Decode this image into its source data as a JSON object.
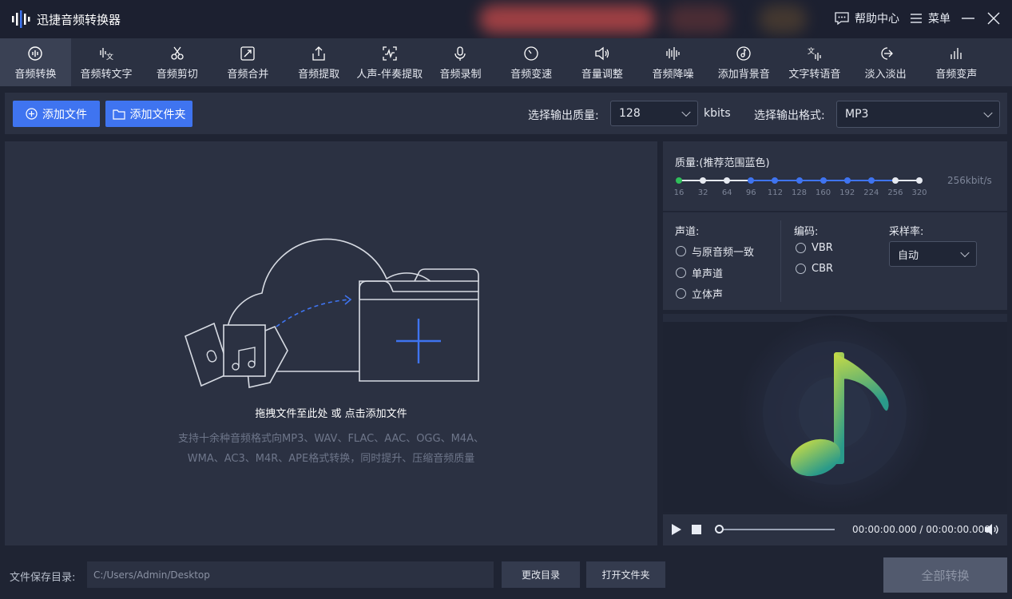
{
  "app": {
    "title": "迅捷音频转换器"
  },
  "header": {
    "help_label": "帮助中心",
    "menu_label": "菜单"
  },
  "toolbar": {
    "items": [
      {
        "label": "音频转换",
        "icon": "audio-convert-icon",
        "active": true
      },
      {
        "label": "音频转文字",
        "icon": "speech-to-text-icon"
      },
      {
        "label": "音频剪切",
        "icon": "scissors-icon"
      },
      {
        "label": "音频合并",
        "icon": "merge-icon"
      },
      {
        "label": "音频提取",
        "icon": "extract-icon"
      },
      {
        "label": "人声-伴奏提取",
        "icon": "vocal-extract-icon"
      },
      {
        "label": "音频录制",
        "icon": "microphone-icon"
      },
      {
        "label": "音频变速",
        "icon": "speed-icon"
      },
      {
        "label": "音量调整",
        "icon": "volume-icon"
      },
      {
        "label": "音频降噪",
        "icon": "denoise-icon"
      },
      {
        "label": "添加背景音",
        "icon": "background-music-icon"
      },
      {
        "label": "文字转语音",
        "icon": "text-to-speech-icon"
      },
      {
        "label": "淡入淡出",
        "icon": "fade-icon"
      },
      {
        "label": "音频变声",
        "icon": "voice-change-icon"
      }
    ]
  },
  "options": {
    "add_file_label": "添加文件",
    "add_folder_label": "添加文件夹",
    "quality_label": "选择输出质量:",
    "quality_value": "128",
    "quality_unit": "kbits",
    "format_label": "选择输出格式:",
    "format_value": "MP3"
  },
  "drop": {
    "main_text": "拖拽文件至此处 或 点击添加文件",
    "sub_line1": "支持十余种音频格式向MP3、WAV、FLAC、AAC、OGG、M4A、",
    "sub_line2": "WMA、AC3、M4R、APE格式转换，同时提升、压缩音频质量"
  },
  "quality": {
    "title": "质量:(推荐范围蓝色)",
    "max_label": "256kbit/s",
    "ticks": [
      "16",
      "32",
      "64",
      "96",
      "112",
      "128",
      "160",
      "192",
      "224",
      "256",
      "320"
    ],
    "recommended_range": [
      "96",
      "256"
    ],
    "current": "16"
  },
  "channel": {
    "title": "声道:",
    "options": [
      "与原音频一致",
      "单声道",
      "立体声"
    ]
  },
  "encoding": {
    "title": "编码:",
    "options": [
      "VBR",
      "CBR"
    ]
  },
  "sample_rate": {
    "title": "采样率:",
    "value": "自动"
  },
  "player": {
    "time": "00:00:00.000 / 00:00:00.000",
    "progress": 0
  },
  "bottom": {
    "save_dir_label": "文件保存目录:",
    "save_dir_value": "C:/Users/Admin/Desktop",
    "change_dir_label": "更改目录",
    "open_folder_label": "打开文件夹",
    "convert_all_label": "全部转换"
  },
  "colors": {
    "accent": "#3f74f0",
    "recommended": "#3f74f0",
    "current_marker": "#2fbf5a",
    "note_gradient_top": "#c8dc45",
    "note_gradient_bottom": "#2a9a8a"
  }
}
